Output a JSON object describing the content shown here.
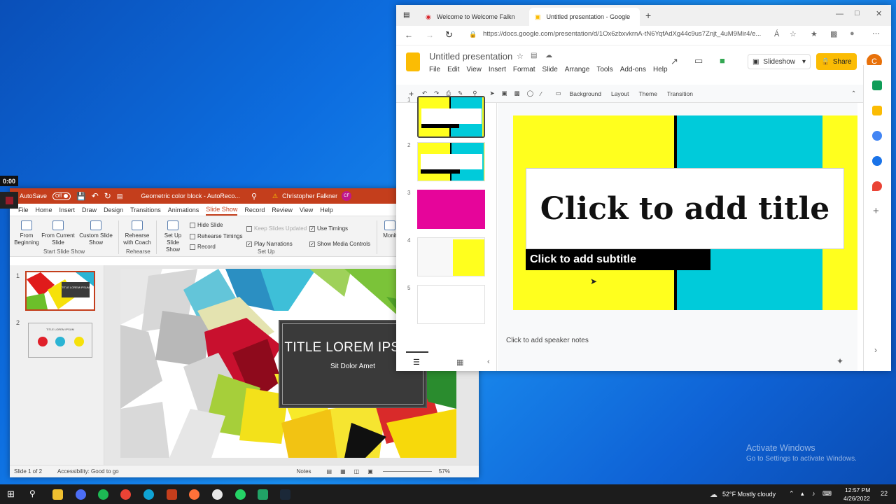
{
  "recorder": {
    "timer": "0:00"
  },
  "ppt": {
    "autosave": "AutoSave",
    "autosave_state": "Off",
    "doc_title": "Geometric color block - AutoReco...",
    "user": "Christopher Falkner",
    "user_initials": "CF",
    "menu": [
      "File",
      "Home",
      "Insert",
      "Draw",
      "Design",
      "Transitions",
      "Animations",
      "Slide Show",
      "Record",
      "Review",
      "View",
      "Help"
    ],
    "ribbon": {
      "from_beginning": "From Beginning",
      "from_current": "From Current Slide",
      "custom": "Custom Slide Show",
      "start_group": "Start Slide Show",
      "rehearse_coach": "Rehearse with Coach",
      "rehearse_group": "Rehearse",
      "setup_show": "Set Up Slide Show",
      "hide_slide": "Hide Slide",
      "rehearse_timings": "Rehearse Timings",
      "record": "Record",
      "keep_updated": "Keep Slides Updated",
      "play_narrations": "Play Narrations",
      "use_timings": "Use Timings",
      "show_media": "Show Media Controls",
      "setup_group": "Set Up",
      "monitor": "Monit"
    },
    "slide_title": "TITLE LOREM IPSUM",
    "slide_subtitle": "Sit Dolor Amet",
    "thumb_nums": [
      "1",
      "2"
    ],
    "thumb1_title": "TITLE LOREM IPSUM",
    "thumb2_title": "TITLE LOREM IPSUM",
    "status": {
      "slide": "Slide 1 of 2",
      "accessibility": "Accessibility: Good to go",
      "notes": "Notes",
      "zoom": "57%"
    }
  },
  "chrome": {
    "tabs": [
      {
        "label": "Welcome to Welcome Falkn"
      },
      {
        "label": "Untitled presentation - Google S"
      }
    ],
    "url": "https://docs.google.com/presentation/d/1Ox6zbxvkrnA-tN6YqfAdXg44c9us7Znjt_4uM9Mir4/e..."
  },
  "slides": {
    "doc_title": "Untitled presentation",
    "menu": [
      "File",
      "Edit",
      "View",
      "Insert",
      "Format",
      "Slide",
      "Arrange",
      "Tools",
      "Add-ons",
      "Help"
    ],
    "slideshow": "Slideshow",
    "share": "Share",
    "avatar": "C",
    "toolbar": {
      "background": "Background",
      "layout": "Layout",
      "theme": "Theme",
      "transition": "Transition"
    },
    "slide_nums": [
      "1",
      "2",
      "3",
      "4",
      "5"
    ],
    "title_placeholder": "Click to add title",
    "subtitle_placeholder": "Click to add subtitle",
    "notes_placeholder": "Click to add speaker notes",
    "colors": {
      "yellow": "#FFFF1E",
      "cyan": "#00CBDA",
      "magenta": "#E6059A",
      "accent": "#FBBC04"
    }
  },
  "activate": {
    "title": "Activate Windows",
    "subtitle": "Go to Settings to activate Windows."
  },
  "taskbar": {
    "weather": "52°F  Mostly cloudy",
    "time": "12:57 PM",
    "date": "4/26/2022",
    "notif": "22"
  }
}
